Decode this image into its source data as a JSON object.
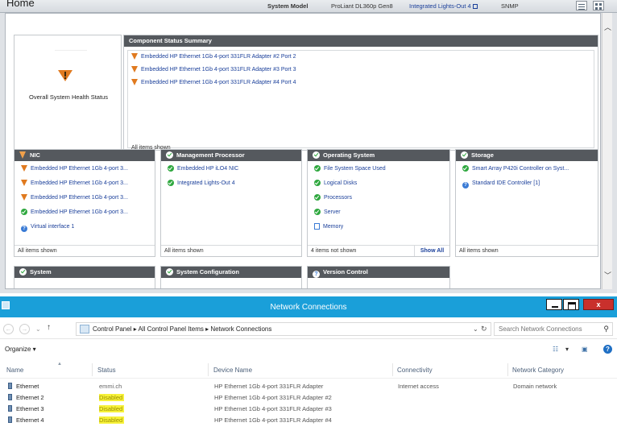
{
  "smh_header": {
    "title": "Home",
    "system_model_label": "System Model",
    "system_model_value": "ProLiant DL360p Gen8",
    "ilo_link": "Integrated Lights-Out 4",
    "protocol": "SNMP"
  },
  "overall_status": {
    "label": "Overall System Health Status",
    "icon": "warning-icon"
  },
  "component_status": {
    "title": "Component Status Summary",
    "items": [
      "Embedded HP Ethernet 1Gb 4-port 331FLR Adapter #2 Port 2",
      "Embedded HP Ethernet 1Gb 4-port 331FLR Adapter #3 Port 3",
      "Embedded HP Ethernet 1Gb 4-port 331FLR Adapter #4 Port 4"
    ],
    "footer": "All items shown"
  },
  "panels": {
    "nic": {
      "title": "NIC",
      "items": [
        {
          "text": "Embedded HP Ethernet 1Gb 4-port 3...",
          "status": "warning"
        },
        {
          "text": "Embedded HP Ethernet 1Gb 4-port 3...",
          "status": "warning"
        },
        {
          "text": "Embedded HP Ethernet 1Gb 4-port 3...",
          "status": "warning"
        },
        {
          "text": "Embedded HP Ethernet 1Gb 4-port 3...",
          "status": "ok"
        },
        {
          "text": "Virtual interface 1",
          "status": "info"
        }
      ],
      "footer": "All items shown"
    },
    "mgmt": {
      "title": "Management Processor",
      "items": [
        {
          "text": "Embedded HP iLO4 NIC",
          "status": "ok"
        },
        {
          "text": "Integrated Lights-Out 4",
          "status": "ok"
        }
      ],
      "footer": "All items shown"
    },
    "os": {
      "title": "Operating System",
      "items": [
        {
          "text": "File System Space Used",
          "status": "ok"
        },
        {
          "text": "Logical Disks",
          "status": "ok"
        },
        {
          "text": "Processors",
          "status": "ok"
        },
        {
          "text": "Server",
          "status": "ok"
        },
        {
          "text": "Memory",
          "status": "doc"
        }
      ],
      "footer": "4 items not shown",
      "show_all": "Show All"
    },
    "storage": {
      "title": "Storage",
      "items": [
        {
          "text": "Smart Array P420i Controller on Syst...",
          "status": "ok"
        },
        {
          "text": "Standard IDE Controller [1]",
          "status": "info"
        }
      ],
      "footer": "All items shown"
    },
    "system": {
      "title": "System"
    },
    "sysconfig": {
      "title": "System Configuration"
    },
    "version": {
      "title": "Version Control"
    }
  },
  "nc_window": {
    "title": "Network Connections",
    "close_glyph": "x",
    "breadcrumbs": "Control Panel  ▸  All Control Panel Items  ▸  Network Connections",
    "search_placeholder": "Search Network Connections",
    "organize": "Organize ▾",
    "columns": [
      "Name",
      "Status",
      "Device Name",
      "Connectivity",
      "Network Category"
    ],
    "rows": [
      {
        "name": "Ethernet",
        "status": "emmi.ch",
        "device": "HP Ethernet 1Gb 4-port 331FLR Adapter",
        "connectivity": "Internet access",
        "category": "Domain network"
      },
      {
        "name": "Ethernet 2",
        "status": "Disabled",
        "device": "HP Ethernet 1Gb 4-port 331FLR Adapter #2",
        "connectivity": "",
        "category": ""
      },
      {
        "name": "Ethernet 3",
        "status": "Disabled",
        "device": "HP Ethernet 1Gb 4-port 331FLR Adapter #3",
        "connectivity": "",
        "category": ""
      },
      {
        "name": "Ethernet 4",
        "status": "Disabled",
        "device": "HP Ethernet 1Gb 4-port 331FLR Adapter #4",
        "connectivity": "",
        "category": ""
      }
    ]
  },
  "colors": {
    "panel_header": "#55595e",
    "warning": "#e07a1f",
    "ok": "#2fa83f",
    "link": "#1a3f9a",
    "titlebar": "#1a9fd9",
    "highlight": "#f7f23a"
  }
}
